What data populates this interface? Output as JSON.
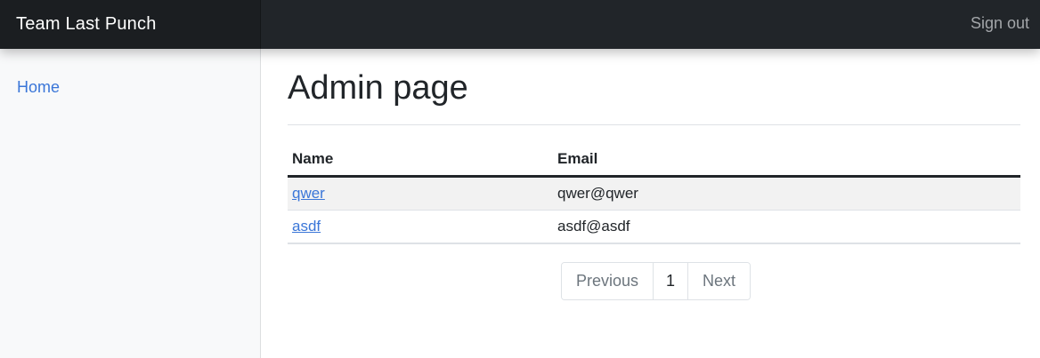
{
  "navbar": {
    "brand": "Team Last Punch",
    "sign_out": "Sign out"
  },
  "sidebar": {
    "items": [
      {
        "label": "Home"
      }
    ]
  },
  "main": {
    "title": "Admin page",
    "table": {
      "columns": [
        "Name",
        "Email"
      ],
      "rows": [
        {
          "name": "qwer",
          "email": "qwer@qwer"
        },
        {
          "name": "asdf",
          "email": "asdf@asdf"
        }
      ]
    },
    "pagination": {
      "previous": "Previous",
      "current_page": "1",
      "next": "Next"
    }
  },
  "colors": {
    "navbar_bg": "#212529",
    "link": "#3a76d8",
    "sidebar_bg": "#f8f9fa"
  }
}
